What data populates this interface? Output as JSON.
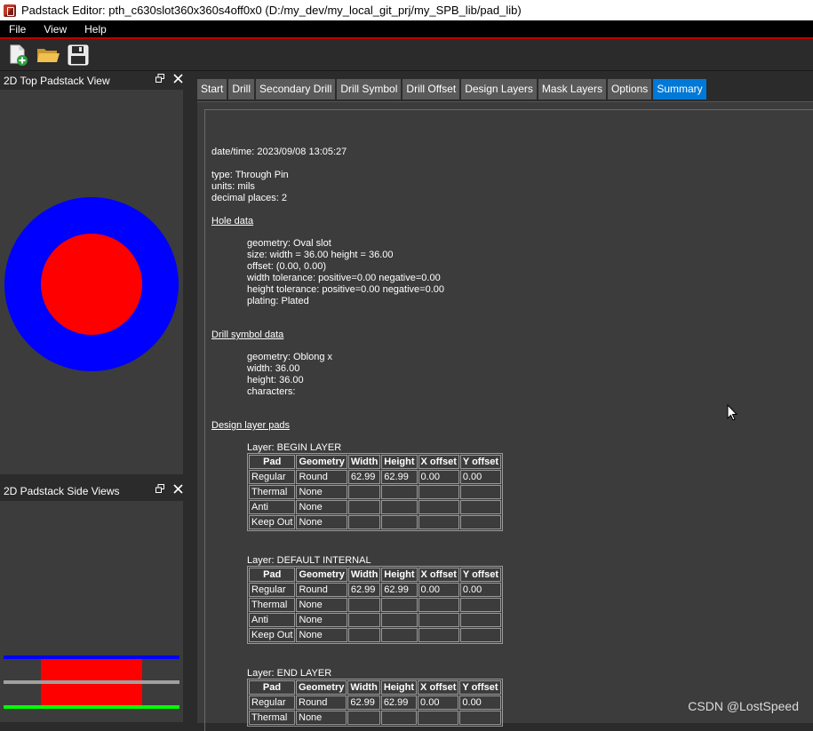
{
  "window": {
    "title": "Padstack Editor: pth_c630slot360x360s4off0x0  (D:/my_dev/my_local_git_prj/my_SPB_lib/pad_lib)"
  },
  "menu": [
    "File",
    "View",
    "Help"
  ],
  "toolbar": {
    "icons": [
      "new-file-icon",
      "open-folder-icon",
      "save-icon"
    ]
  },
  "panels": {
    "top_view_title": "2D Top Padstack View",
    "side_view_title": "2D Padstack Side Views"
  },
  "tabs": [
    "Start",
    "Drill",
    "Secondary Drill",
    "Drill Symbol",
    "Drill Offset",
    "Design Layers",
    "Mask Layers",
    "Options",
    "Summary"
  ],
  "active_tab": "Summary",
  "summary": {
    "datetime": "date/time: 2023/09/08 13:05:27",
    "type": "type: Through Pin",
    "units": "units: mils",
    "decimal": "decimal places: 2",
    "hole_heading": "Hole data",
    "hole": [
      "geometry: Oval slot",
      "size: width = 36.00 height = 36.00",
      "offset: (0.00, 0.00)",
      "width tolerance: positive=0.00 negative=0.00",
      "height tolerance: positive=0.00 negative=0.00",
      "plating: Plated"
    ],
    "drill_heading": "Drill symbol data",
    "drill": [
      "geometry: Oblong x",
      "width: 36.00",
      "height: 36.00",
      "characters:"
    ],
    "design_heading": "Design layer pads",
    "table_headers": [
      "Pad",
      "Geometry",
      "Width",
      "Height",
      "X offset",
      "Y offset"
    ],
    "layers": [
      {
        "label": "Layer: BEGIN LAYER",
        "rows": [
          [
            "Regular",
            "Round",
            "62.99",
            "62.99",
            "0.00",
            "0.00"
          ],
          [
            "Thermal",
            "None",
            "",
            "",
            "",
            ""
          ],
          [
            "Anti",
            "None",
            "",
            "",
            "",
            ""
          ],
          [
            "Keep Out",
            "None",
            "",
            "",
            "",
            ""
          ]
        ]
      },
      {
        "label": "Layer: DEFAULT INTERNAL",
        "rows": [
          [
            "Regular",
            "Round",
            "62.99",
            "62.99",
            "0.00",
            "0.00"
          ],
          [
            "Thermal",
            "None",
            "",
            "",
            "",
            ""
          ],
          [
            "Anti",
            "None",
            "",
            "",
            "",
            ""
          ],
          [
            "Keep Out",
            "None",
            "",
            "",
            "",
            ""
          ]
        ]
      },
      {
        "label": "Layer: END LAYER",
        "rows": [
          [
            "Regular",
            "Round",
            "62.99",
            "62.99",
            "0.00",
            "0.00"
          ],
          [
            "Thermal",
            "None",
            "",
            "",
            "",
            ""
          ]
        ]
      }
    ]
  },
  "watermark": "CSDN @LostSpeed",
  "colors": {
    "pad": "#0000ff",
    "drill": "#ff0000",
    "accent": "#0078d7",
    "menu_underline": "#c00000",
    "side_green": "#00ff00",
    "side_gray": "#a0a0a0"
  }
}
